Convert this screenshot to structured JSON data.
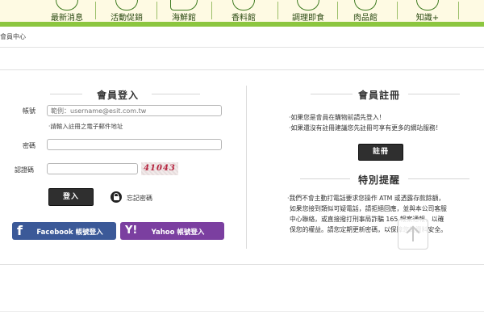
{
  "nav": {
    "items": [
      {
        "label": "最新消息"
      },
      {
        "label": "活動促銷"
      },
      {
        "label": "海鮮館"
      },
      {
        "label": "香料館"
      },
      {
        "label": "調理即食"
      },
      {
        "label": "肉品館"
      },
      {
        "label": "知識+"
      }
    ]
  },
  "breadcrumb": "會員中心",
  "login": {
    "title": "會員登入",
    "account_label": "帳號",
    "account_placeholder": "範例：username@esit.com.tw",
    "account_hint": "‧請輸入註冊之電子郵件地址",
    "password_label": "密碼",
    "captcha_label": "認證碼",
    "captcha_code": "41043",
    "login_button": "登入",
    "remember_label": "忘記密碼",
    "facebook_button": "Facebook 帳號登入",
    "yahoo_button": "Yahoo 帳號登入"
  },
  "register": {
    "title": "會員註冊",
    "line1": "‧如果您是會員在購物前請先登入！",
    "line2": "‧如果還沒有註冊建議您先註冊可享有更多的網站服務！",
    "button": "註冊"
  },
  "notice": {
    "title": "特別提醒",
    "lines": [
      "‧我們不會主動打電話要求您操作 ATM 或透露存款餘額，",
      "如果您接到類似可疑電話，請拒絕回應，並與本公司客服",
      "中心聯絡，或直接撥打刑事局詐騙 165 報案通報，以確",
      "保您的權益。請您定期更新密碼，以保障您的資料安全。"
    ]
  },
  "colors": {
    "nav_bg": "#fefae3",
    "nav_green": "#8cc63f",
    "facebook": "#3b5998",
    "yahoo": "#7b3fa0",
    "captcha": "#b5233e"
  },
  "icons": {
    "facebook": "facebook-icon",
    "yahoo": "yahoo-icon",
    "lock": "lock-icon",
    "back_to_top": "arrow-up-icon"
  }
}
